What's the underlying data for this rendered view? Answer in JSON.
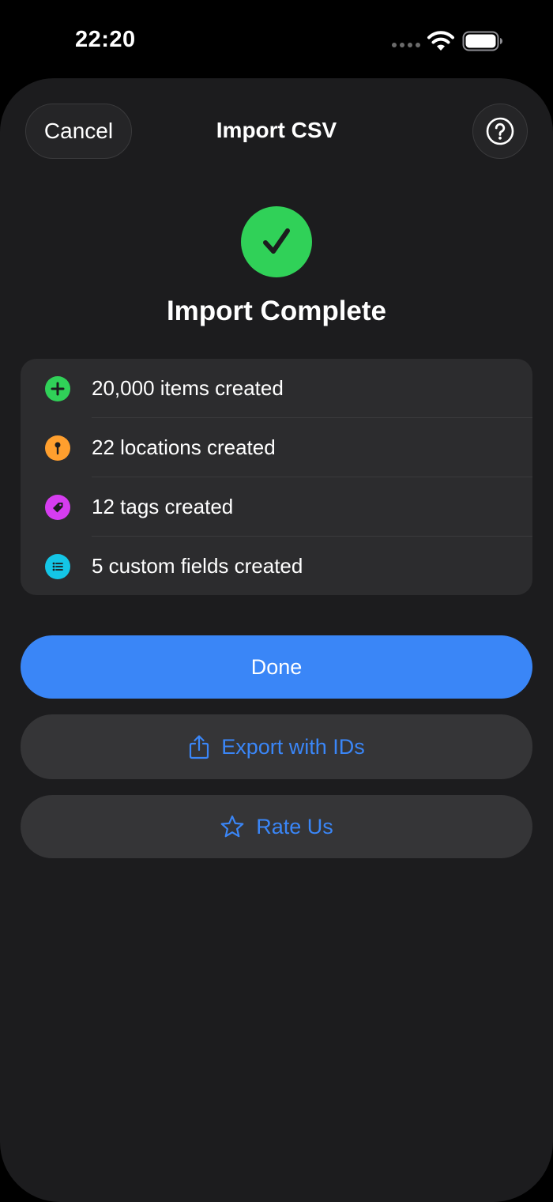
{
  "status_bar": {
    "time": "22:20",
    "icons": [
      "signal-dots-icon",
      "wifi-icon",
      "battery-icon"
    ]
  },
  "nav": {
    "cancel_label": "Cancel",
    "title": "Import CSV",
    "help_icon": "question-circle-icon"
  },
  "result": {
    "icon": "checkmark-circle-icon",
    "headline": "Import Complete"
  },
  "summary": {
    "items": [
      {
        "label": "20,000 items created",
        "icon": "plus-circle-icon",
        "color": "#30d158"
      },
      {
        "label": "22 locations created",
        "icon": "pin-circle-icon",
        "color": "#ff9f2e"
      },
      {
        "label": "12 tags created",
        "icon": "tag-circle-icon",
        "color": "#d63df0"
      },
      {
        "label": "5 custom fields created",
        "icon": "list-circle-icon",
        "color": "#14c6e6"
      }
    ]
  },
  "actions": {
    "done_label": "Done",
    "export_label": "Export with IDs",
    "export_icon": "share-icon",
    "rate_label": "Rate Us",
    "rate_icon": "star-icon"
  },
  "colors": {
    "background": "#000000",
    "sheet": "#1c1c1e",
    "card": "#2c2c2e",
    "accent": "#3a86f7",
    "success": "#30d158"
  }
}
